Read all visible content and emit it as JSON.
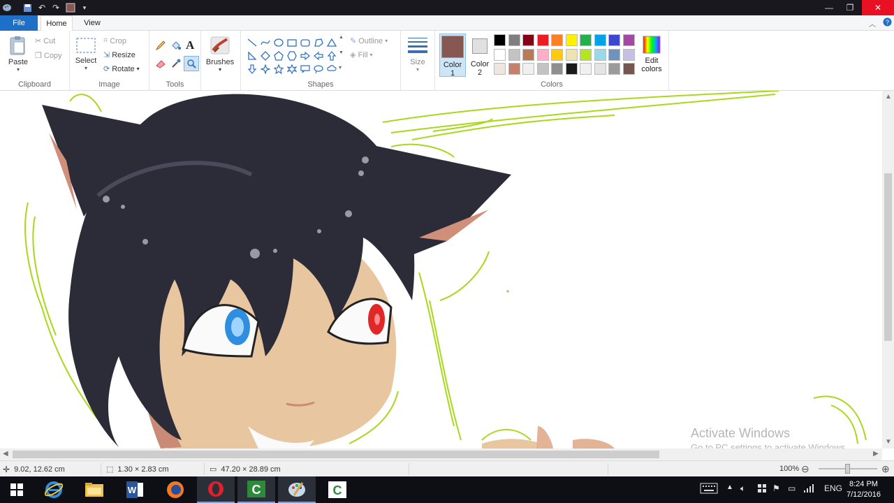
{
  "ribbon": {
    "tabs": {
      "file": "File",
      "home": "Home",
      "view": "View"
    },
    "clipboard": {
      "paste": "Paste",
      "cut": "Cut",
      "copy": "Copy",
      "label": "Clipboard"
    },
    "image": {
      "select": "Select",
      "crop": "Crop",
      "resize": "Resize",
      "rotate": "Rotate",
      "label": "Image"
    },
    "tools": {
      "label": "Tools",
      "items": [
        "pencil-icon",
        "fill-bucket-icon",
        "text-icon",
        "eraser-icon",
        "color-picker-icon",
        "magnifier-icon"
      ]
    },
    "brushes": {
      "label": "Brushes"
    },
    "shapes": {
      "outline": "Outline",
      "fill": "Fill",
      "label": "Shapes"
    },
    "size": {
      "label": "Size"
    },
    "colors": {
      "color1_label": "Color",
      "color1_num": "1",
      "color2_label": "Color",
      "color2_num": "2",
      "edit_label": "Edit",
      "edit_label2": "colors",
      "label": "Colors",
      "color1": "#875851",
      "color2": "#e0e0e0",
      "palette": [
        "#000000",
        "#7f7f7f",
        "#880015",
        "#ed1c24",
        "#ff7f27",
        "#fff200",
        "#22b14c",
        "#00a2e8",
        "#3f48cc",
        "#a349a4",
        "#ffffff",
        "#c3c3c3",
        "#b97a57",
        "#ffaec9",
        "#ffc90e",
        "#efe4b0",
        "#b5e61d",
        "#99d9ea",
        "#7092be",
        "#c8bfe7",
        "#efe6e1",
        "#c8806a",
        "#f0f0f0",
        "#c3c3c3",
        "#8f8f8f",
        "#1a1a1a",
        "#f0f0f0",
        "#e4e4e4",
        "#9b9b9b",
        "#7a5550"
      ]
    }
  },
  "status": {
    "cursor_pos": "9.02, 12.62 cm",
    "selection_size": "1.30 × 2.83 cm",
    "image_size": "47.20 × 28.89 cm",
    "zoom": "100%"
  },
  "watermark": {
    "line1": "Activate Windows",
    "line2": "Go to PC settings to activate Windows."
  },
  "taskbar": {
    "apps": [
      "windows-start-icon",
      "internet-explorer-icon",
      "file-explorer-icon",
      "word-icon",
      "firefox-icon",
      "opera-icon",
      "camtasia-recorder-icon",
      "paint-icon",
      "camtasia-studio-icon"
    ],
    "language": "ENG",
    "time": "8:24 PM",
    "date": "7/12/2016"
  }
}
